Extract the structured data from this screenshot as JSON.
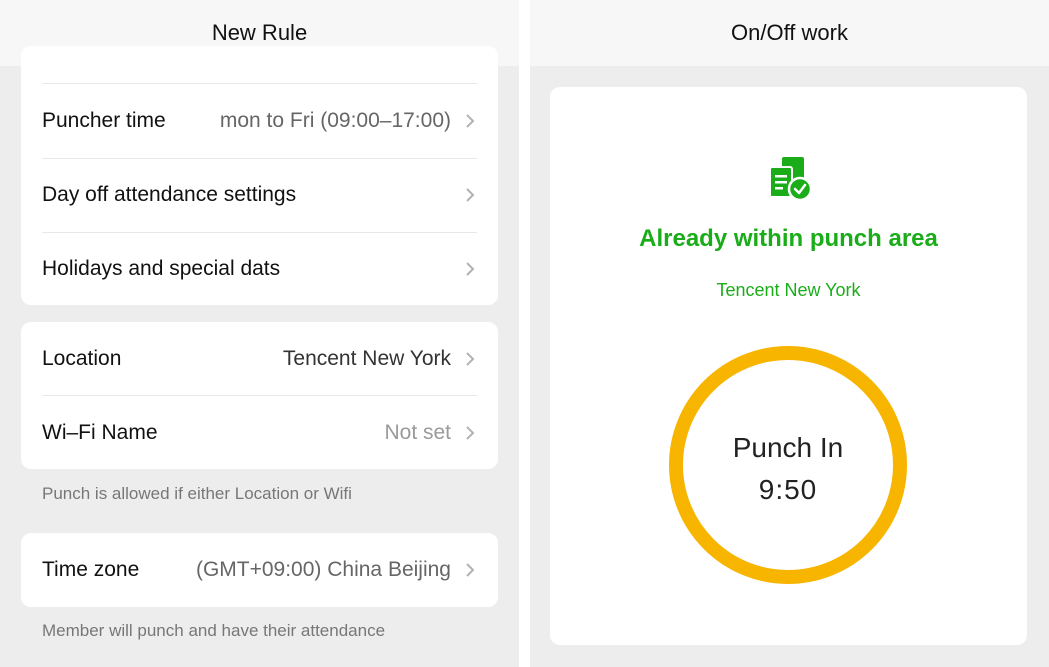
{
  "left": {
    "title": "New Rule",
    "schedule_rows": [
      {
        "label": "Puncher time",
        "value": "mon to Fri  (09:00–17:00)"
      },
      {
        "label": "Day off attendance settings",
        "value": ""
      },
      {
        "label": "Holidays and special dats",
        "value": ""
      }
    ],
    "location_rows": [
      {
        "label": "Location",
        "value": "Tencent New York"
      },
      {
        "label": "Wi–Fi Name",
        "value": "Not set"
      }
    ],
    "location_note": "Punch is allowed if either Location or Wifi",
    "timezone_row": {
      "label": "Time zone",
      "value": "(GMT+09:00) China Beijing"
    },
    "timezone_note": "Member will punch and have their attendance"
  },
  "right": {
    "title": "On/Off work",
    "status_title": "Already within punch area",
    "status_location": "Tencent New York",
    "punch_label": "Punch In",
    "punch_time": "9:50"
  },
  "icons": {
    "chevron": "chevron-right-icon",
    "status": "attendance-check-icon"
  },
  "colors": {
    "accent_green": "#1aad19",
    "punch_ring": "#f7b500",
    "background": "#ededed"
  }
}
